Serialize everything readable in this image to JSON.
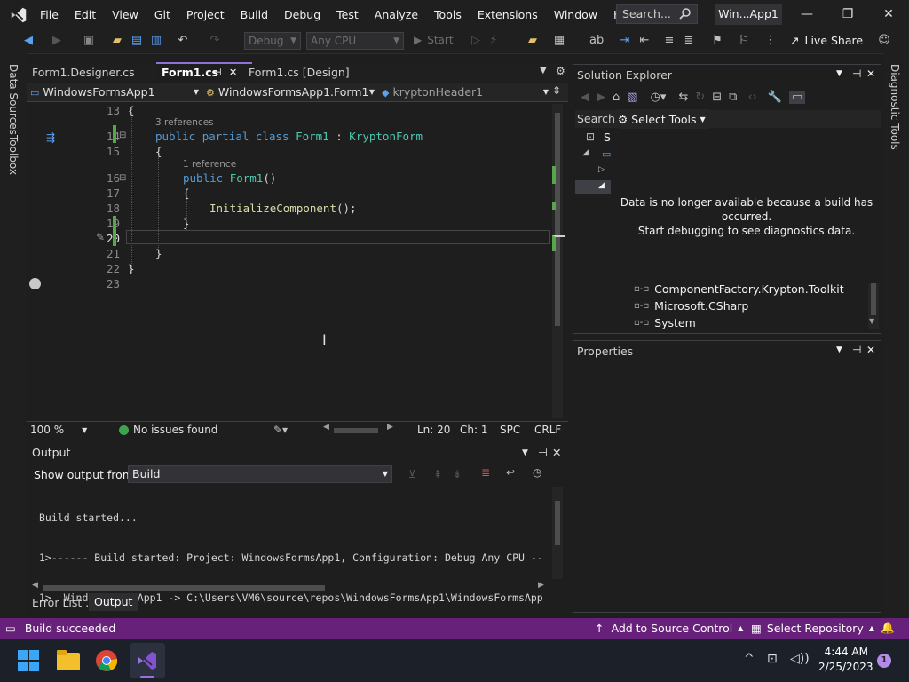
{
  "titlebar": {
    "menu": [
      "File",
      "Edit",
      "View",
      "Git",
      "Project",
      "Build",
      "Debug",
      "Test",
      "Analyze",
      "Tools",
      "Extensions",
      "Window",
      "Help"
    ],
    "search_placeholder": "Search...",
    "solution_badge": "Win...App1",
    "minimize": "—",
    "restore": "❐",
    "close": "✕"
  },
  "toolbar": {
    "config_combo": "Debug",
    "platform_combo": "Any CPU",
    "start_label": "Start",
    "live_share": "Live Share"
  },
  "leftstrip": {
    "tab1": "Data Sources",
    "tab2": "Toolbox"
  },
  "rightstrip": {
    "tab1": "Diagnostic Tools"
  },
  "doctabs": {
    "tab1": "Form1.Designer.cs",
    "tab2": "Form1.cs",
    "tab2_pin": "⊣",
    "tab2_close": "✕",
    "tab3": "Form1.cs [Design]"
  },
  "navbar": {
    "project": "WindowsFormsApp1",
    "class": "WindowsFormsApp1.Form1",
    "member": "kryptonHeader1"
  },
  "editor": {
    "lines": [
      "13",
      "14",
      "15",
      "16",
      "17",
      "18",
      "19",
      "20",
      "21",
      "22",
      "23"
    ],
    "refs_class": "3 references",
    "refs_ctor": "1 reference",
    "brace_open": "{",
    "brace_close": "}",
    "kw_public": "public",
    "kw_partial": "partial",
    "kw_class": "class",
    "class_name": "Form1",
    "colon": " : ",
    "base_type": "KryptonForm",
    "ctor_name": "Form1",
    "parens": "()",
    "call_name": "InitializeComponent",
    "call_tail": "();"
  },
  "edstatus": {
    "zoom": "100 %",
    "issues": "No issues found",
    "line": "Ln: 20",
    "col": "Ch: 1",
    "spc": "SPC",
    "eol": "CRLF"
  },
  "output": {
    "title": "Output",
    "show_from_label": "Show output from:",
    "source": "Build",
    "lines": [
      "Build started...",
      "1>------ Build started: Project: WindowsFormsApp1, Configuration: Debug Any CPU --",
      "1>  WindowsFormsApp1 -> C:\\Users\\VM6\\source\\repos\\WindowsFormsApp1\\WindowsFormsApp"
    ],
    "tab_errors": "Error List ...",
    "tab_output": "Output"
  },
  "solution_explorer": {
    "title": "Solution Explorer",
    "search_label": "Search",
    "select_tools": "Select Tools",
    "tree_s": "S",
    "diag_message_1": "Data is no longer available because a build has occurred.",
    "diag_message_2": "Start debugging to see diagnostics data.",
    "refs": [
      "ComponentFactory.Krypton.Toolkit",
      "Microsoft.CSharp",
      "System"
    ]
  },
  "properties": {
    "title": "Properties"
  },
  "statusbar": {
    "build_status": "Build succeeded",
    "source_control": "Add to Source Control",
    "repository": "Select Repository"
  },
  "taskbar": {
    "time": "4:44 AM",
    "date": "2/25/2023",
    "notif_count": "1"
  },
  "colors": {
    "accent": "#68217a",
    "keyword": "#569cd6",
    "type": "#4ec9b0",
    "method": "#dcdcaa"
  }
}
